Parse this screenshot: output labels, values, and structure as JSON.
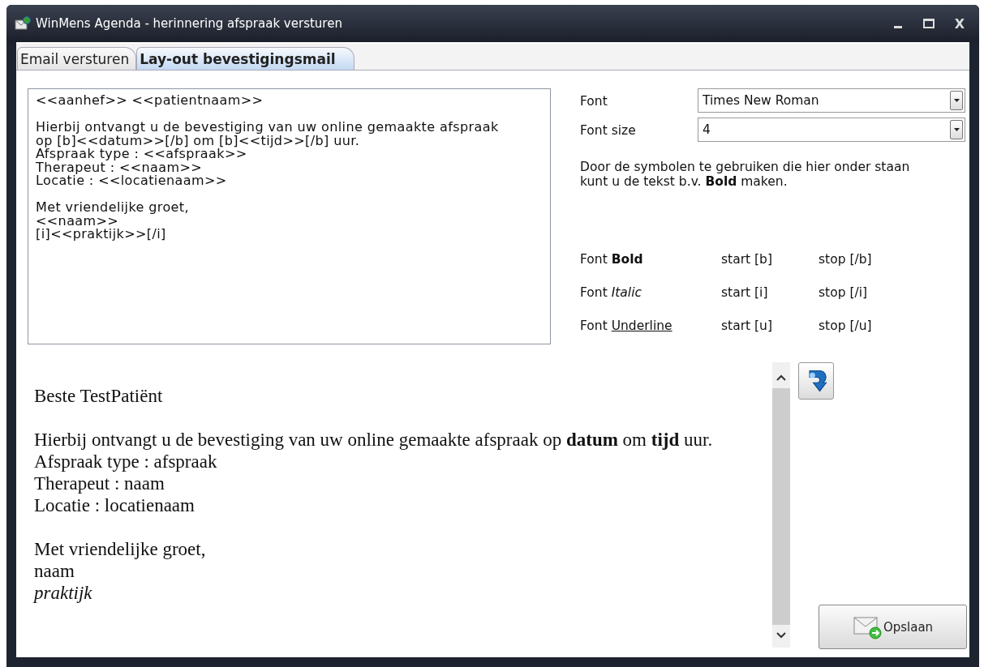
{
  "window": {
    "title": "WinMens Agenda - herinnering afspraak versturen",
    "close_label": "X"
  },
  "tabs": [
    {
      "label": "Email versturen",
      "selected": false
    },
    {
      "label": "Lay-out bevestigingsmail",
      "selected": true
    }
  ],
  "template": {
    "paragraphs": [
      [
        "<<aanhef>> <<patientnaam>>"
      ],
      [
        "Hierbij ontvangt u de bevestiging van uw online gemaakte afspraak",
        "op [b]<<datum>>[/b] om [b]<<tijd>>[/b] uur.",
        "Afspraak type : <<afspraak>>",
        "Therapeut : <<naam>>",
        "Locatie : <<locatienaam>>"
      ],
      [
        "Met vriendelijke groet,",
        "<<naam>>",
        "[i]<<praktijk>>[/i]"
      ]
    ]
  },
  "settings": [
    {
      "label": "Font",
      "value": "Times New Roman"
    },
    {
      "label": "Font size",
      "value": "4"
    }
  ],
  "help_text": "Door de symbolen te gebruiken die hier onder staan kunt u de tekst b.v. **Bold** maken.",
  "format_codes": [
    {
      "kind": "bold",
      "label": "Font",
      "style_word": "Bold",
      "start": "start [b]",
      "stop": "stop [/b]"
    },
    {
      "kind": "italic",
      "label": "Font",
      "style_word": "Italic",
      "start": "start [i]",
      "stop": "stop [/i]"
    },
    {
      "kind": "underline",
      "label": "Font",
      "style_word": "Underline",
      "start": "start [u]",
      "stop": "stop [/u]"
    }
  ],
  "preview": {
    "paragraphs": [
      [
        "Beste TestPatiënt"
      ],
      [
        "Hierbij ontvangt u de bevestiging van uw online gemaakte afspraak op **datum** om **tijd** uur.",
        "Afspraak type : afspraak",
        "Therapeut : naam",
        "Locatie : locatienaam"
      ],
      [
        "Met vriendelijke groet,",
        "naam",
        "*praktijk*"
      ]
    ]
  },
  "save_button": "Opslaan"
}
